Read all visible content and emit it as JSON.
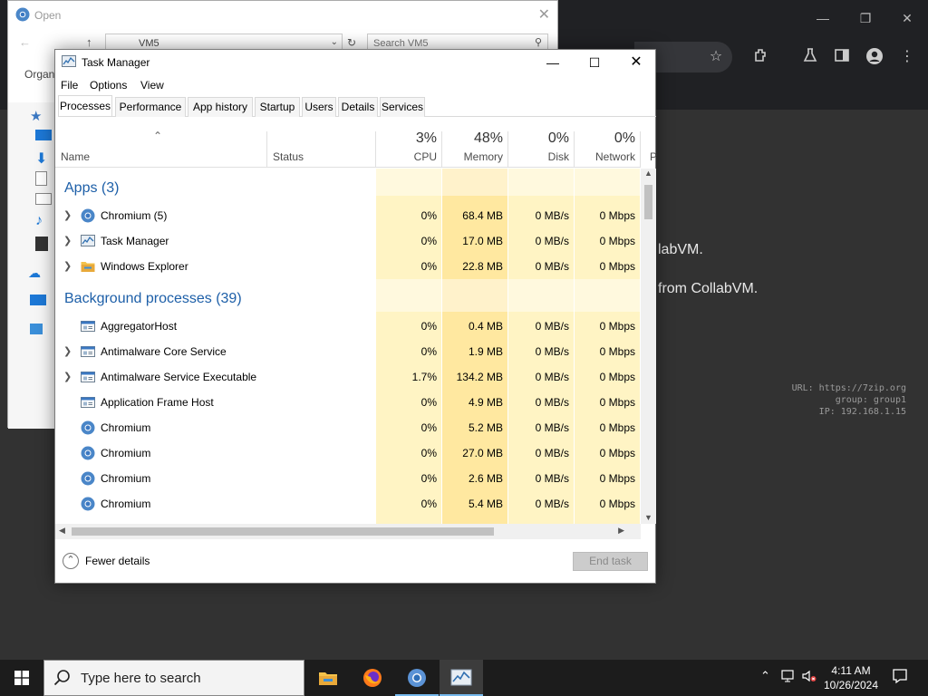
{
  "open_dialog": {
    "title": "Open",
    "path": "VM5",
    "search_placeholder": "Search VM5",
    "organize": "Organ"
  },
  "background": {
    "line1": "labVM.",
    "line2": "from CollabVM.",
    "url_line": "URL: https://7zip.org",
    "group_line": "group: group1",
    "ip_line": "IP: 192.168.1.15"
  },
  "task_manager": {
    "title": "Task Manager",
    "menu": [
      "File",
      "Options",
      "View"
    ],
    "tabs": [
      "Processes",
      "Performance",
      "App history",
      "Startup",
      "Users",
      "Details",
      "Services"
    ],
    "active_tab": "Processes",
    "columns": {
      "name": "Name",
      "status": "Status",
      "cpu_label": "CPU",
      "cpu_pct": "3%",
      "memory_label": "Memory",
      "memory_pct": "48%",
      "disk_label": "Disk",
      "disk_pct": "0%",
      "network_label": "Network",
      "network_pct": "0%",
      "cut_label": "P"
    },
    "groups": {
      "apps": "Apps (3)",
      "background": "Background processes (39)"
    },
    "apps": [
      {
        "name": "Chromium (5)",
        "icon": "chromium-icon",
        "expandable": true,
        "cpu": "0%",
        "memory": "68.4 MB",
        "disk": "0 MB/s",
        "network": "0 Mbps"
      },
      {
        "name": "Task Manager",
        "icon": "task-manager-icon",
        "expandable": true,
        "cpu": "0%",
        "memory": "17.0 MB",
        "disk": "0 MB/s",
        "network": "0 Mbps"
      },
      {
        "name": "Windows Explorer",
        "icon": "folder-icon",
        "expandable": true,
        "cpu": "0%",
        "memory": "22.8 MB",
        "disk": "0 MB/s",
        "network": "0 Mbps"
      }
    ],
    "background_processes": [
      {
        "name": "AggregatorHost",
        "icon": "service-icon",
        "expandable": false,
        "cpu": "0%",
        "memory": "0.4 MB",
        "disk": "0 MB/s",
        "network": "0 Mbps"
      },
      {
        "name": "Antimalware Core Service",
        "icon": "service-icon",
        "expandable": true,
        "cpu": "0%",
        "memory": "1.9 MB",
        "disk": "0 MB/s",
        "network": "0 Mbps"
      },
      {
        "name": "Antimalware Service Executable",
        "icon": "service-icon",
        "expandable": true,
        "cpu": "1.7%",
        "memory": "134.2 MB",
        "disk": "0 MB/s",
        "network": "0 Mbps"
      },
      {
        "name": "Application Frame Host",
        "icon": "service-icon",
        "expandable": false,
        "cpu": "0%",
        "memory": "4.9 MB",
        "disk": "0 MB/s",
        "network": "0 Mbps"
      },
      {
        "name": "Chromium",
        "icon": "chromium-icon",
        "expandable": false,
        "cpu": "0%",
        "memory": "5.2 MB",
        "disk": "0 MB/s",
        "network": "0 Mbps"
      },
      {
        "name": "Chromium",
        "icon": "chromium-icon",
        "expandable": false,
        "cpu": "0%",
        "memory": "27.0 MB",
        "disk": "0 MB/s",
        "network": "0 Mbps"
      },
      {
        "name": "Chromium",
        "icon": "chromium-icon",
        "expandable": false,
        "cpu": "0%",
        "memory": "2.6 MB",
        "disk": "0 MB/s",
        "network": "0 Mbps"
      },
      {
        "name": "Chromium",
        "icon": "chromium-icon",
        "expandable": false,
        "cpu": "0%",
        "memory": "5.4 MB",
        "disk": "0 MB/s",
        "network": "0 Mbps"
      }
    ],
    "fewer_details": "Fewer details",
    "end_task": "End task"
  },
  "taskbar": {
    "search_placeholder": "Type here to search",
    "time": "4:11 AM",
    "date": "10/26/2024",
    "pinned": [
      "file-explorer-icon",
      "firefox-icon",
      "chromium-icon",
      "task-manager-icon"
    ]
  },
  "colors": {
    "heat_light": "#fff4c4",
    "heat_mid": "#ffe8a0",
    "group_blue": "#1d5fa8",
    "taskbar": "#1c1c1c"
  }
}
